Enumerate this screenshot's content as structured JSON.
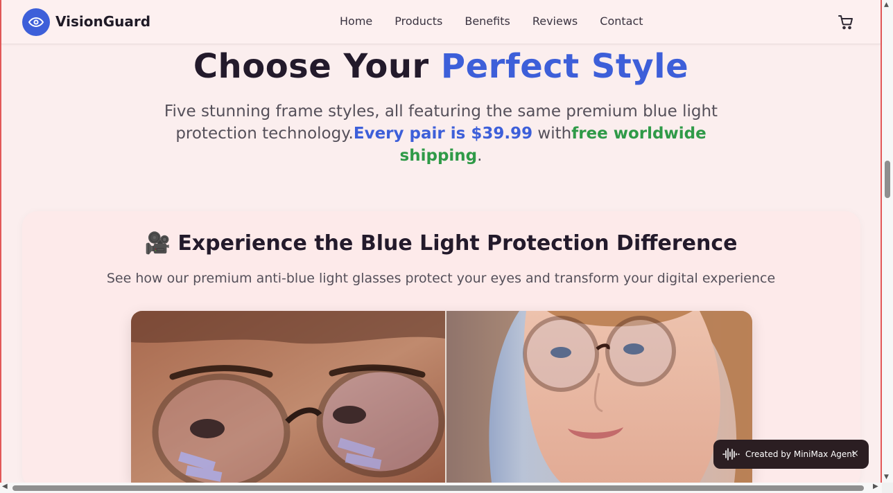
{
  "brand": {
    "name": "VisionGuard",
    "logo_icon": "eye-icon",
    "accent": "#3d5fd9"
  },
  "nav": {
    "links": [
      "Home",
      "Products",
      "Benefits",
      "Reviews",
      "Contact"
    ],
    "cart_icon": "cart-icon"
  },
  "hero": {
    "title_part1": "Choose Your ",
    "title_accent": "Perfect Style",
    "sub_part1": "Five stunning frame styles, all featuring the same premium blue light protection technology.",
    "sub_price": "Every pair is $39.99",
    "sub_part2": " with",
    "sub_shipping": "free worldwide shipping",
    "sub_end": "."
  },
  "card": {
    "emoji": "🎥",
    "title": "Experience the Blue Light Protection Difference",
    "subtitle": "See how our premium anti-blue light glasses protect your eyes and transform your digital experience"
  },
  "badge": {
    "text": "Created by MiniMax Agent",
    "close": "×",
    "icon": "waveform-icon"
  },
  "colors": {
    "blue": "#3d5fd9",
    "green": "#2f9a48",
    "background": "#fbeeee"
  }
}
